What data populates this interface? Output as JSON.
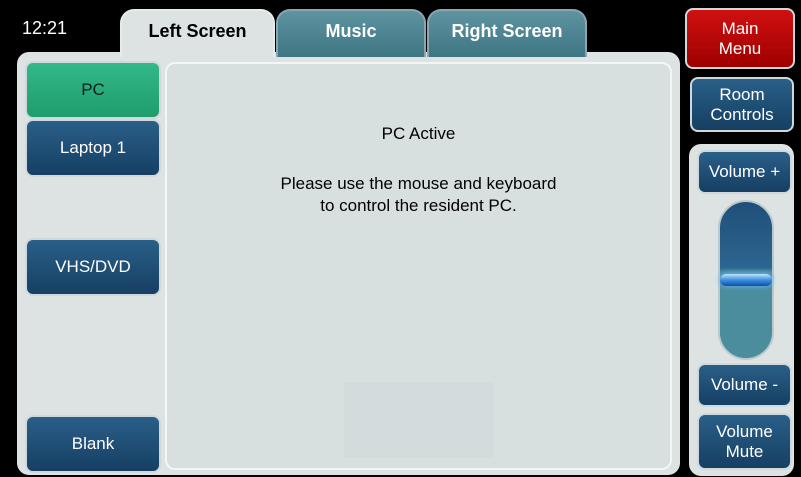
{
  "clock": "12:21",
  "tabs": [
    {
      "label": "Left Screen",
      "active": true
    },
    {
      "label": "Music",
      "active": false
    },
    {
      "label": "Right Screen",
      "active": false
    }
  ],
  "sources": [
    {
      "label": "PC",
      "selected": true
    },
    {
      "label": "Laptop 1",
      "selected": false
    },
    {
      "label": "VHS/DVD",
      "selected": false
    },
    {
      "label": "Blank",
      "selected": false
    }
  ],
  "content": {
    "title": "PC Active",
    "line1": "Please use the mouse and keyboard",
    "line2": "to control the resident PC."
  },
  "right": {
    "main_menu": "Main Menu",
    "room_controls": "Room Controls",
    "volume_up": "Volume +",
    "volume_down": "Volume -",
    "volume_mute": "Volume Mute",
    "volume_level": 0.45
  },
  "colors": {
    "selected_green": "#2aae7c",
    "button_blue": "#1c4a73",
    "main_menu_red": "#c00000",
    "panel_gray": "#dde3e3"
  }
}
